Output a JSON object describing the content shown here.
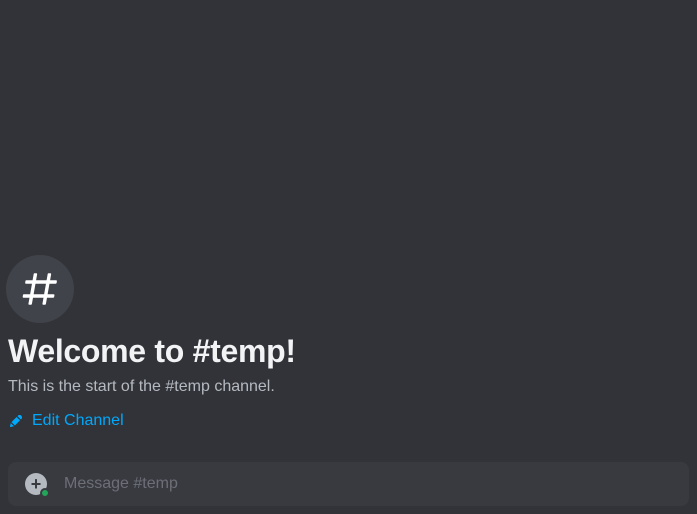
{
  "channel": {
    "name": "temp",
    "welcome_title": "Welcome to #temp!",
    "welcome_subtitle": "This is the start of the #temp channel.",
    "edit_link_label": "Edit Channel"
  },
  "composer": {
    "placeholder": "Message #temp"
  }
}
